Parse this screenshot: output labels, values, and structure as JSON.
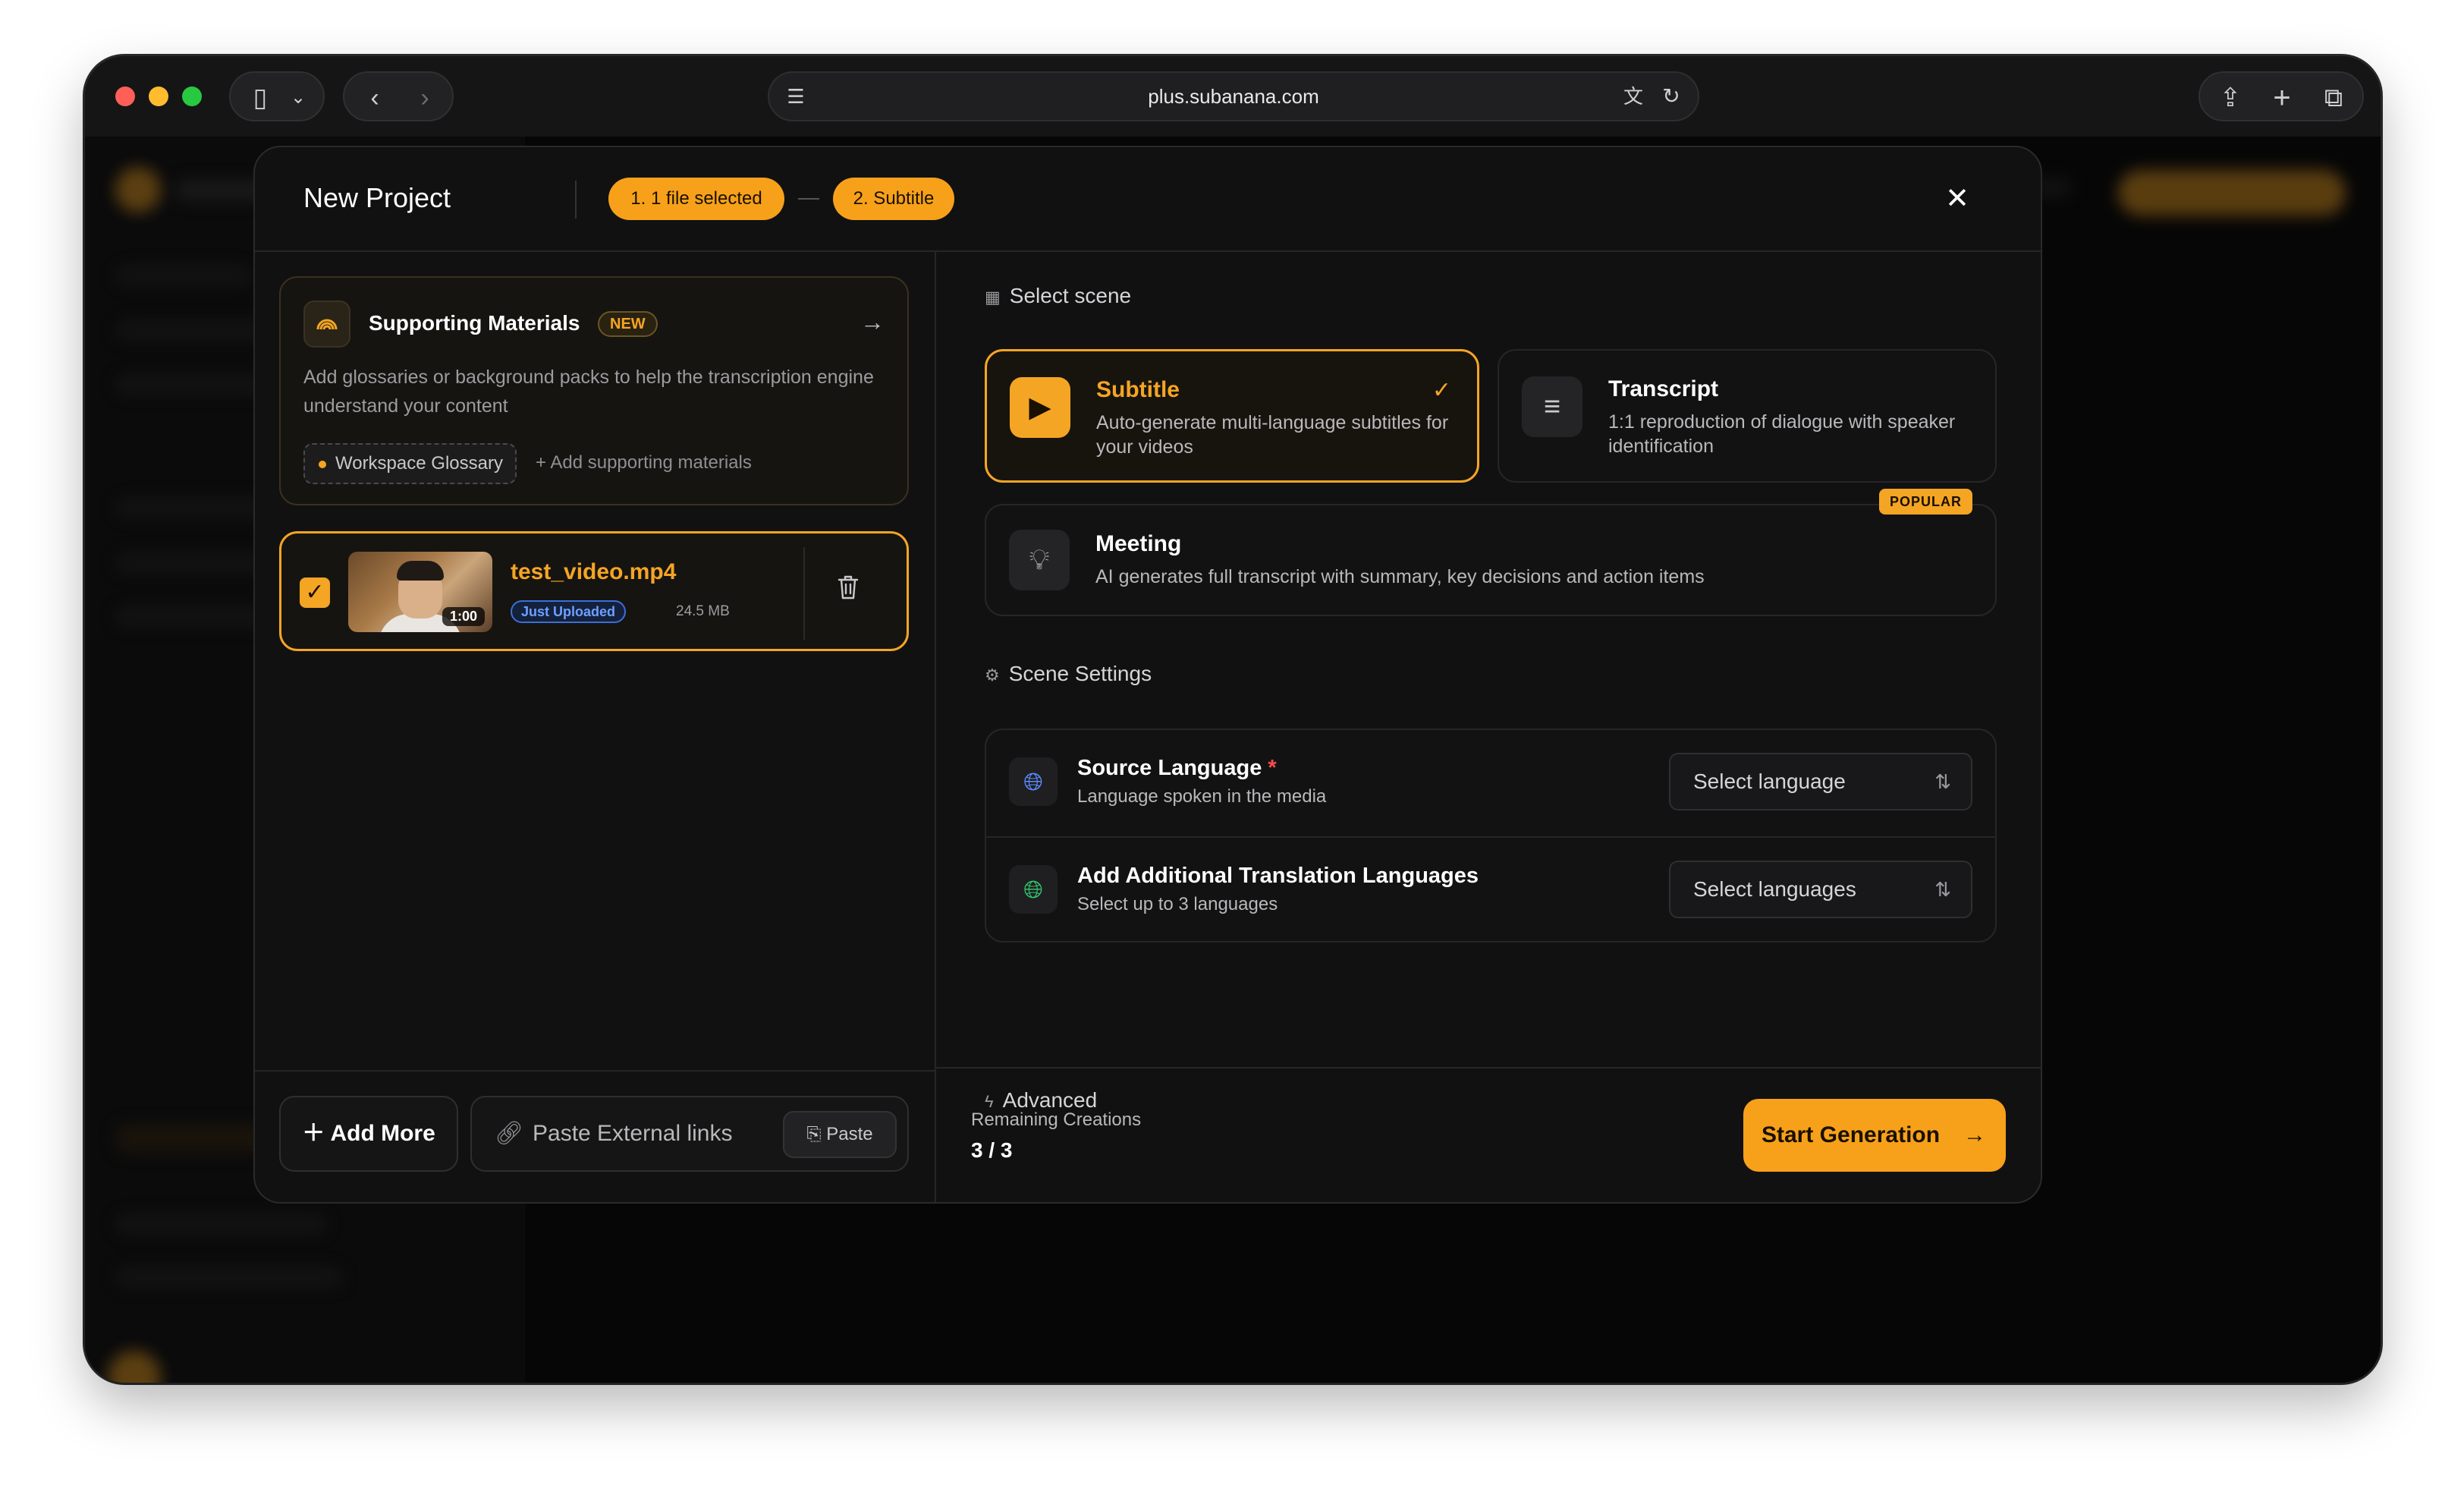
{
  "browser": {
    "url": "plus.subanana.com"
  },
  "modal": {
    "title": "New Project",
    "steps": [
      "1. 1 file selected",
      "2. Subtitle"
    ],
    "close_icon": "close-icon"
  },
  "supporting": {
    "title": "Supporting Materials",
    "badge": "NEW",
    "description": "Add glossaries or background packs to help the transcription engine understand your content",
    "glossary": "Workspace Glossary",
    "add_label": "Add supporting materials"
  },
  "file": {
    "name": "test_video.mp4",
    "duration": "1:00",
    "status": "Just Uploaded",
    "size": "24.5 MB",
    "checked": true
  },
  "left_footer": {
    "add_more": "Add More",
    "paste_placeholder": "Paste External links",
    "paste_button": "Paste"
  },
  "scene": {
    "label": "Select scene",
    "options": [
      {
        "title": "Subtitle",
        "desc": "Auto-generate multi-language subtitles for your videos",
        "selected": true
      },
      {
        "title": "Transcript",
        "desc": "1:1 reproduction of dialogue with speaker identification",
        "selected": false
      },
      {
        "title": "Meeting",
        "desc": "AI generates full transcript with summary, key decisions and action items",
        "badge": "POPULAR",
        "selected": false
      }
    ]
  },
  "settings": {
    "label": "Scene Settings",
    "source": {
      "title": "Source Language",
      "required": "*",
      "subtitle": "Language spoken in the media",
      "placeholder": "Select language"
    },
    "translation": {
      "title": "Add Additional Translation Languages",
      "subtitle": "Select up to 3 languages",
      "placeholder": "Select languages"
    }
  },
  "advanced": {
    "label": "Advanced"
  },
  "footer": {
    "remaining_label": "Remaining Creations",
    "remaining_value": "3 / 3",
    "start_button": "Start Generation"
  },
  "colors": {
    "accent": "#f5a524",
    "background": "#111112",
    "uploaded_badge": "#6ea0ff"
  }
}
